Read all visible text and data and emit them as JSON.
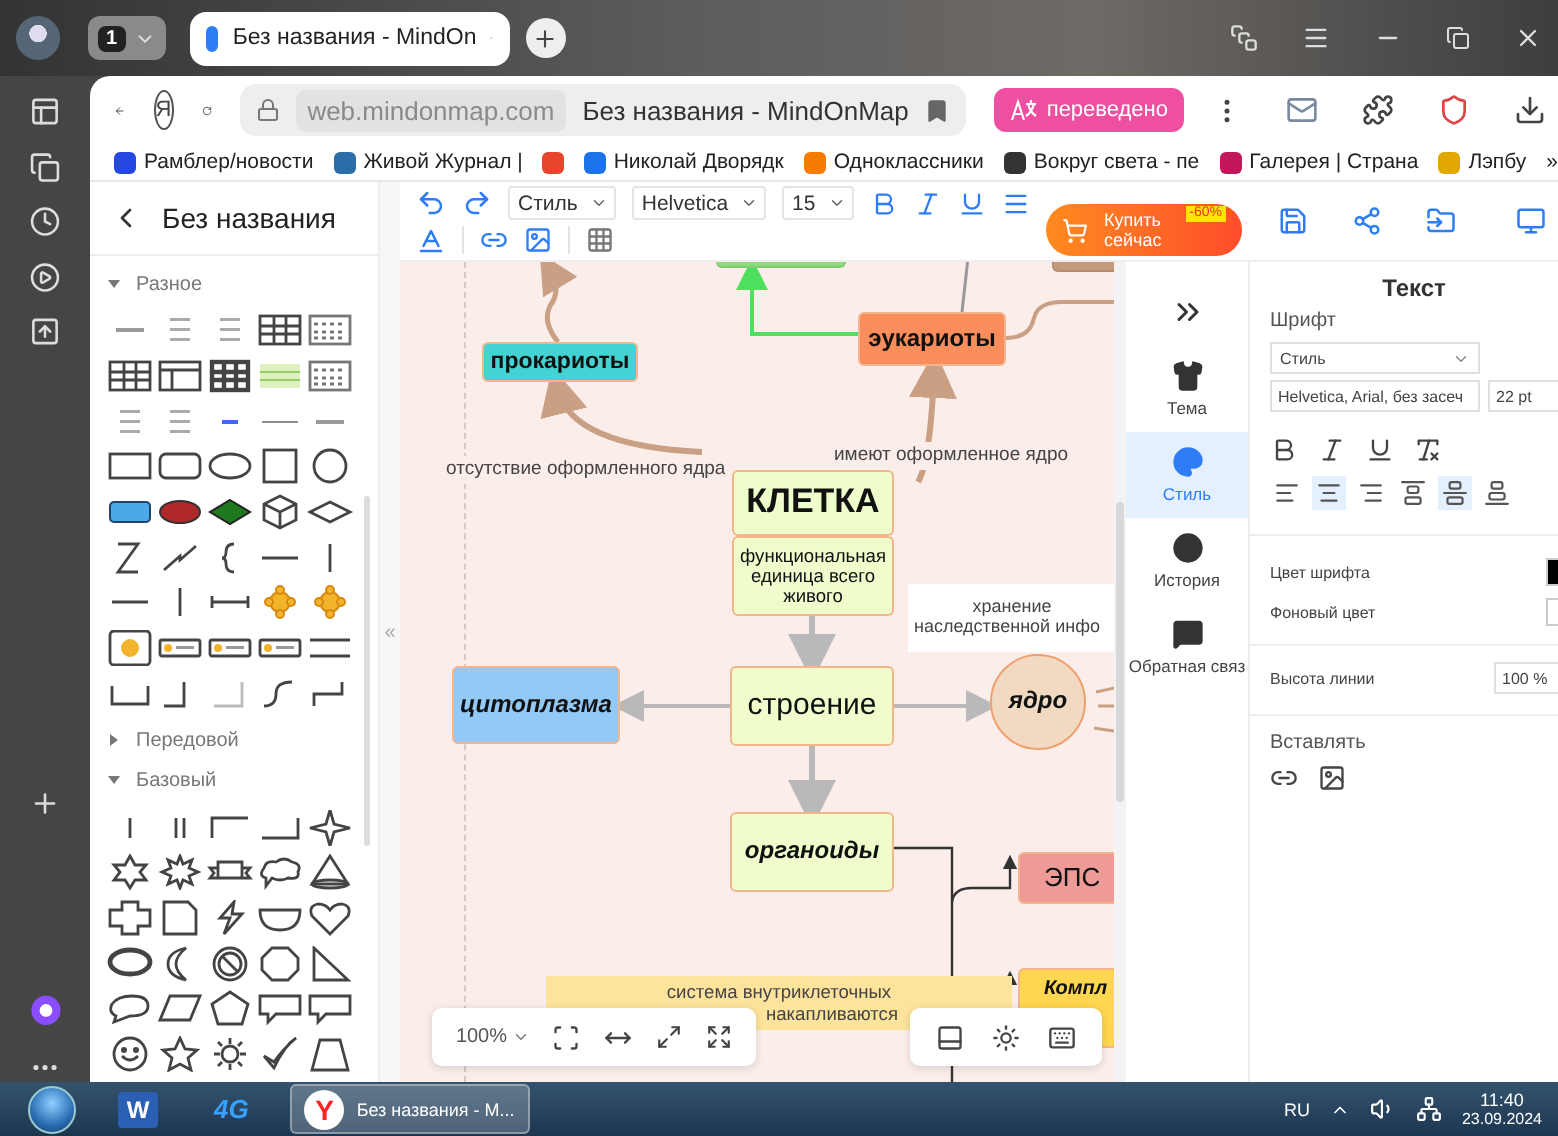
{
  "browser": {
    "profile_counter": "1",
    "tab": {
      "title": "Без названия - MindOn",
      "selected": true
    },
    "yandex_button": "Я",
    "address": {
      "domain": "web.mindonmap.com",
      "title": "Без названия - MindOnMap"
    },
    "translate_badge": "переведено",
    "bookmarks": [
      {
        "label": "Рамблер/новости",
        "color": "#2448e0"
      },
      {
        "label": "Живой Журнал |",
        "color": "#2c6fa8"
      },
      {
        "kind": "icon",
        "color": "#e8452c"
      },
      {
        "label": "Николай Дворядк",
        "color": "#1a73e8"
      },
      {
        "label": "Одноклассники",
        "color": "#f57c00"
      },
      {
        "label": "Вокруг света - пе",
        "color": "#333333"
      },
      {
        "label": "Галерея | Страна",
        "color": "#c2185b"
      },
      {
        "label": "Лэпбу",
        "color": "#e0a800"
      }
    ],
    "more_bookmarks": "»"
  },
  "editor": {
    "title": "Без названия",
    "palette": [
      {
        "label": "Разное",
        "expanded": true
      },
      {
        "label": "Передовой",
        "expanded": false
      },
      {
        "label": "Базовый",
        "expanded": true
      }
    ],
    "collapse_handle": "«"
  },
  "toolbar": {
    "style": "Стиль",
    "font": "Helvetica",
    "size": "15",
    "buy_button": {
      "lines": [
        "Купить",
        "сейчас"
      ],
      "discount": "-60%"
    }
  },
  "canvas": {
    "nodes": [
      {
        "kind": "stub",
        "color": "#8fdc7f"
      },
      {
        "kind": "stub",
        "color": "#c39a7a"
      },
      {
        "kind": "box",
        "text": "прокариоты",
        "color": "#43d3d3"
      },
      {
        "kind": "box",
        "text": "эукариоты",
        "color": "#f98e5c"
      },
      {
        "kind": "label",
        "text": "отсутствие оформленного ядра"
      },
      {
        "kind": "label",
        "text": "имеют оформленное ядро"
      },
      {
        "kind": "box",
        "text": "КЛЕТКА",
        "color": "#effccb"
      },
      {
        "kind": "box",
        "text": "функциональная единица всего живого",
        "color": "#effccb"
      },
      {
        "kind": "note",
        "lines": [
          "хранение",
          "наследственной инфо"
        ],
        "color": "#ffffff"
      },
      {
        "kind": "box",
        "text": "цитоплазма",
        "color": "#93c9f7"
      },
      {
        "kind": "box",
        "text": "строение",
        "color": "#effccb"
      },
      {
        "kind": "circle",
        "text": "ядро",
        "color": "#f1d9c2"
      },
      {
        "kind": "box",
        "text": "органоиды",
        "color": "#effccb"
      },
      {
        "kind": "box",
        "text": "ЭПС",
        "color": "#ee9b98"
      },
      {
        "kind": "note",
        "lines": [
          "система внутриклеточных",
          "накапливаются"
        ],
        "color": "#fde39c"
      },
      {
        "kind": "box",
        "text": "Компл",
        "color": "#fed64f"
      }
    ],
    "zoom": "100%"
  },
  "side_nav": [
    {
      "label": "Тема",
      "selected": false
    },
    {
      "label": "Стиль",
      "selected": true
    },
    {
      "label": "История",
      "selected": false
    },
    {
      "label": "Обратная связ",
      "selected": false
    }
  ],
  "properties": {
    "title": "Текст",
    "font_heading": "Шрифт",
    "style_select": "Стиль",
    "font_family": "Helvetica, Arial, без засеч",
    "font_size": "22 pt",
    "align_buttons": [
      {
        "selected": false
      },
      {
        "selected": true
      },
      {
        "selected": false
      },
      {
        "selected": false
      },
      {
        "selected": true
      },
      {
        "selected": false
      }
    ],
    "font_color": {
      "label": "Цвет шрифта",
      "color": "#000000"
    },
    "background_color": {
      "label": "Фоновый цвет",
      "color": "#ffffff"
    },
    "line_height": {
      "label": "Высота линии",
      "value": "100 %"
    },
    "insert_heading": "Вставлять"
  },
  "taskbar": {
    "apps": [
      {
        "kind": "word",
        "icon_text": "W",
        "selected": false
      },
      {
        "kind": "modem",
        "icon_text": "4G",
        "selected": false
      },
      {
        "kind": "browser",
        "icon_text": "Y",
        "label": "Без названия - М...",
        "selected": true
      }
    ],
    "language": "RU",
    "time": "11:40",
    "date": "23.09.2024"
  }
}
